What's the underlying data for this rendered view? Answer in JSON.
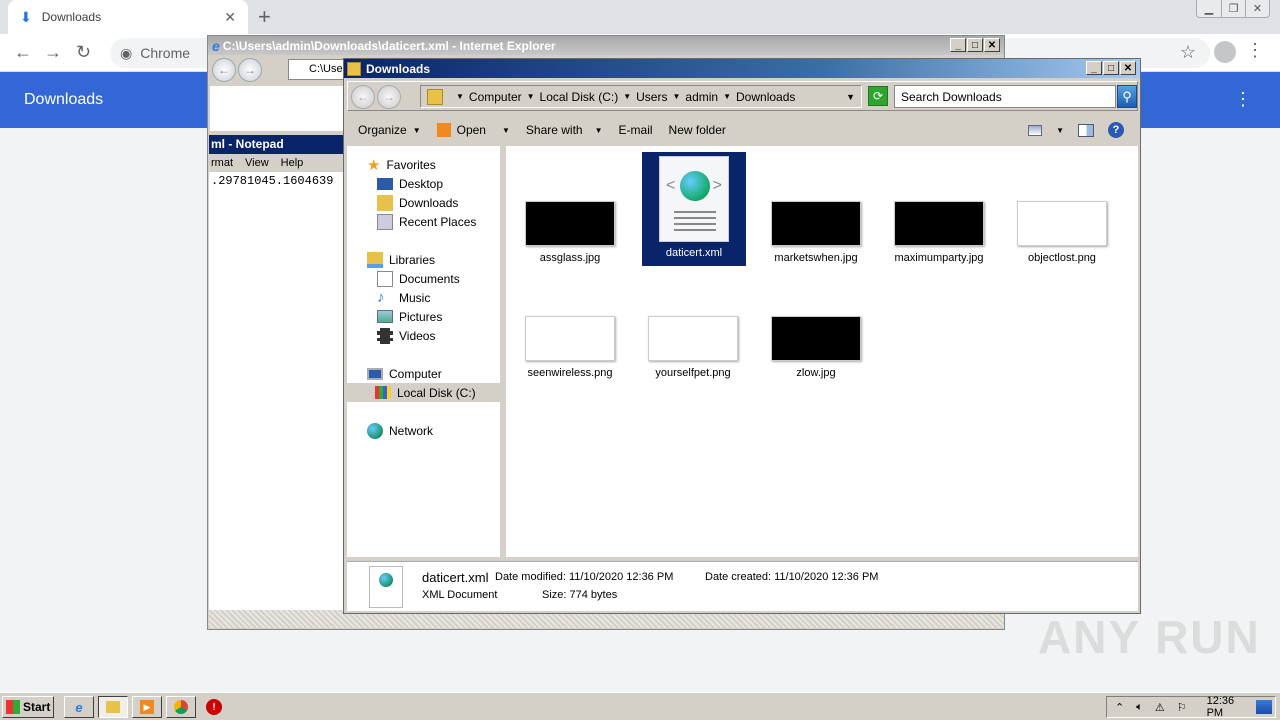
{
  "chrome": {
    "tab_title": "Downloads",
    "omnibox_label": "Chrome",
    "page_header": "Downloads"
  },
  "ie": {
    "title": "C:\\Users\\admin\\Downloads\\daticert.xml - Internet Explorer",
    "address": "C:\\Use"
  },
  "notepad": {
    "title": "ml - Notepad",
    "menu": [
      "rmat",
      "View",
      "Help"
    ],
    "text": ".29781045.1604639"
  },
  "explorer": {
    "title": "Downloads",
    "breadcrumbs": [
      "Computer",
      "Local Disk (C:)",
      "Users",
      "admin",
      "Downloads"
    ],
    "search_placeholder": "Search Downloads",
    "commands": {
      "organize": "Organize",
      "open": "Open",
      "share": "Share with",
      "email": "E-mail",
      "new_folder": "New folder"
    },
    "nav": {
      "favorites": "Favorites",
      "desktop": "Desktop",
      "downloads": "Downloads",
      "recent": "Recent Places",
      "libraries": "Libraries",
      "documents": "Documents",
      "music": "Music",
      "pictures": "Pictures",
      "videos": "Videos",
      "computer": "Computer",
      "local_disk": "Local Disk (C:)",
      "network": "Network"
    },
    "files": [
      {
        "name": "assglass.jpg",
        "thumb": "#000000"
      },
      {
        "name": "daticert.xml",
        "thumb": "xml",
        "selected": true
      },
      {
        "name": "marketswhen.jpg",
        "thumb": "#000000"
      },
      {
        "name": "maximumparty.jpg",
        "thumb": "#000000"
      },
      {
        "name": "objectlost.png",
        "thumb": "#ffffff"
      },
      {
        "name": "seenwireless.png",
        "thumb": "#ffffff"
      },
      {
        "name": "yourselfpet.png",
        "thumb": "#ffffff"
      },
      {
        "name": "zlow.jpg",
        "thumb": "#000000"
      }
    ],
    "details": {
      "name": "daticert.xml",
      "type": "XML Document",
      "date_modified": "Date modified: 11/10/2020 12:36 PM",
      "date_created": "Date created: 11/10/2020 12:36 PM",
      "size": "Size: 774 bytes"
    }
  },
  "taskbar": {
    "start": "Start",
    "clock": "12:36 PM"
  },
  "watermark": "ANY RUN"
}
